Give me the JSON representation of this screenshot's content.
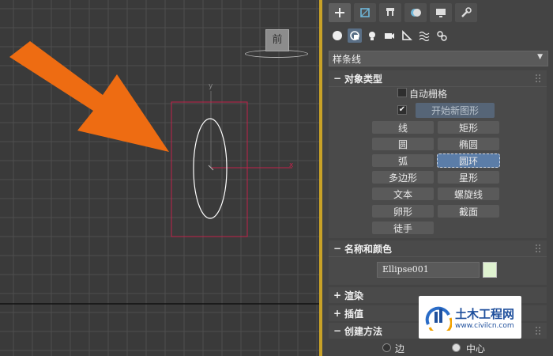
{
  "viewport": {
    "view_label": "前",
    "axis_x": "x",
    "axis_y": "y"
  },
  "command_panel": {
    "tabs": [
      "create-icon",
      "modify-icon",
      "hierarchy-icon",
      "motion-icon",
      "display-icon",
      "utilities-icon"
    ],
    "subtabs": [
      "geometry-icon",
      "shapes-icon",
      "lights-icon",
      "cameras-icon",
      "helpers-icon",
      "spacewarps-icon",
      "systems-icon"
    ],
    "category": "样条线",
    "object_type": {
      "header": "对象类型",
      "autogrid_label": "自动栅格",
      "start_new_shape_label": "开始新图形",
      "start_new_shape_checked": "✔",
      "buttons": {
        "line": "线",
        "rectangle": "矩形",
        "circle": "圆",
        "ellipse": "椭圆",
        "arc": "弧",
        "donut": "圆环",
        "ngon": "多边形",
        "star": "星形",
        "text": "文本",
        "helix": "螺旋线",
        "egg": "卵形",
        "section": "截面",
        "freehand": "徒手"
      },
      "selected": "donut"
    },
    "name_color": {
      "header": "名称和颜色",
      "name_value": "Ellipse001",
      "color": "#dff2d0"
    },
    "render": {
      "header": "渲染"
    },
    "interpolation": {
      "header": "插值"
    },
    "creation_method": {
      "header": "创建方法",
      "edge_label": "边",
      "center_label": "中心"
    }
  },
  "watermark": {
    "title": "土木工程网",
    "url": "www.civilcn.com"
  },
  "colors": {
    "arrow": "#ee6c12",
    "bbox": "#c0224a",
    "panel_accent": "#c9a227"
  }
}
